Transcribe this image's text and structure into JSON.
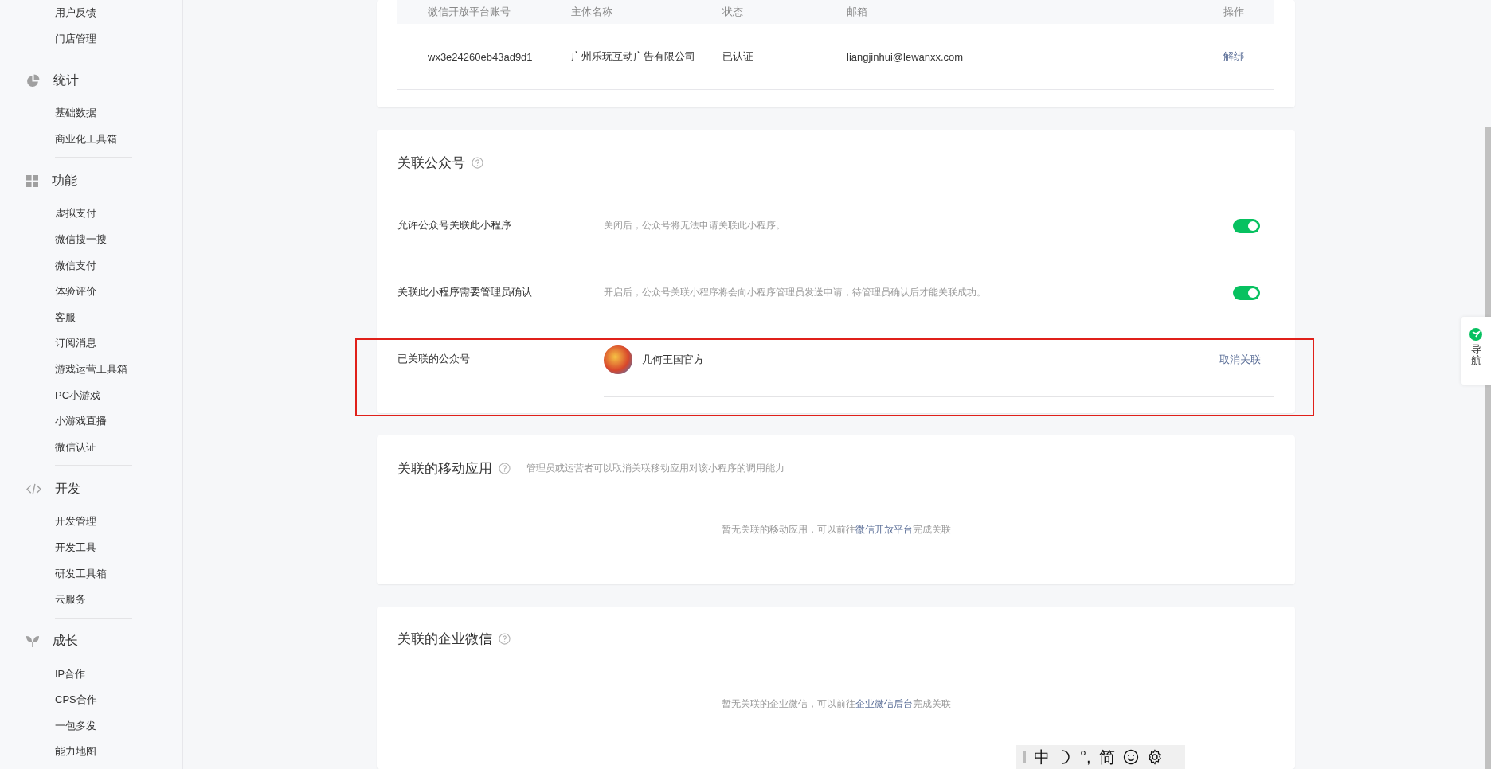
{
  "sidebar": {
    "top_items": [
      "用户反馈",
      "门店管理"
    ],
    "groups": [
      {
        "title": "统计",
        "items": [
          "基础数据",
          "商业化工具箱"
        ]
      },
      {
        "title": "功能",
        "items": [
          "虚拟支付",
          "微信搜一搜",
          "微信支付",
          "体验评价",
          "客服",
          "订阅消息",
          "游戏运营工具箱",
          "PC小游戏",
          "小游戏直播",
          "微信认证"
        ]
      },
      {
        "title": "开发",
        "items": [
          "开发管理",
          "开发工具",
          "研发工具箱",
          "云服务"
        ]
      },
      {
        "title": "成长",
        "items": [
          "IP合作",
          "CPS合作",
          "一包多发",
          "能力地图"
        ]
      }
    ]
  },
  "open_platform_table": {
    "columns": [
      "微信开放平台账号",
      "主体名称",
      "状态",
      "邮箱",
      "操作"
    ],
    "rows": [
      {
        "account": "wx3e24260eb43ad9d1",
        "entity": "广州乐玩互动广告有限公司",
        "status": "已认证",
        "email": "liangjinhui@lewanxx.com",
        "action": "解绑"
      }
    ]
  },
  "official_accounts": {
    "title": "关联公众号",
    "settings": [
      {
        "label": "允许公众号关联此小程序",
        "description": "关闭后，公众号将无法申请关联此小程序。",
        "on": true
      },
      {
        "label": "关联此小程序需要管理员确认",
        "description": "开启后，公众号关联小程序将会向小程序管理员发送申请，待管理员确认后才能关联成功。",
        "on": true
      }
    ],
    "linked": {
      "label": "已关联的公众号",
      "name": "几何王国官方",
      "action": "取消关联",
      "highlighted": true
    }
  },
  "mobile_apps": {
    "title": "关联的移动应用",
    "subtitle": "管理员或运营者可以取消关联移动应用对该小程序的调用能力",
    "empty": {
      "before": "暂无关联的移动应用，可以前往",
      "link": "微信开放平台",
      "after": "完成关联"
    }
  },
  "work_wechat": {
    "title": "关联的企业微信",
    "empty": {
      "before": "暂无关联的企业微信，可以前往",
      "link": "企业微信后台",
      "after": "完成关联"
    }
  },
  "nav_widget": {
    "label": "导航"
  },
  "ime_bar": {
    "mode": "中",
    "punctuation": "°,",
    "script": "简"
  }
}
